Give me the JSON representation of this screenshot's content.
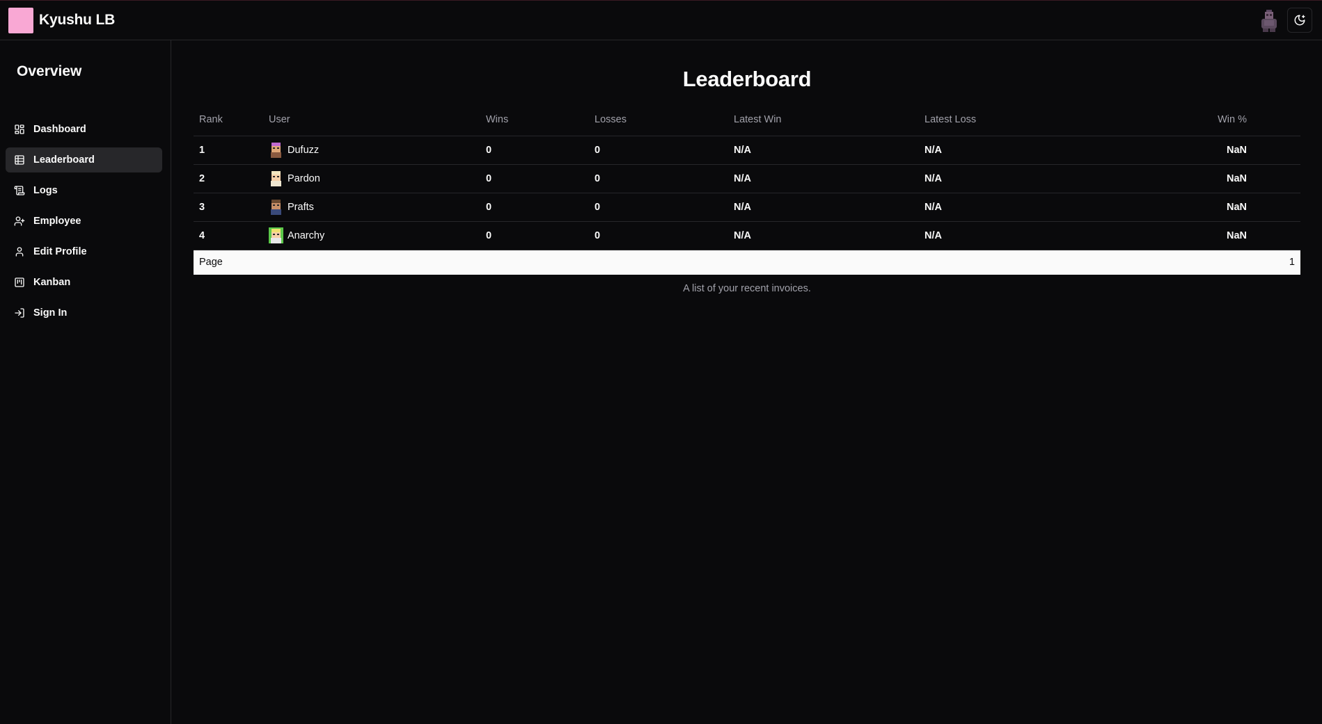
{
  "app": {
    "title": "Kyushu LB",
    "accent": "#f9a8d4"
  },
  "header": {
    "theme_toggle_icon": "moon-sun-icon",
    "avatar_icon": "user-avatar-icon"
  },
  "sidebar": {
    "heading": "Overview",
    "items": [
      {
        "label": "Dashboard",
        "icon": "dashboard-icon",
        "active": false
      },
      {
        "label": "Leaderboard",
        "icon": "table-icon",
        "active": true
      },
      {
        "label": "Logs",
        "icon": "scroll-icon",
        "active": false
      },
      {
        "label": "Employee",
        "icon": "user-plus-icon",
        "active": false
      },
      {
        "label": "Edit Profile",
        "icon": "user-icon",
        "active": false
      },
      {
        "label": "Kanban",
        "icon": "kanban-icon",
        "active": false
      },
      {
        "label": "Sign In",
        "icon": "sign-in-icon",
        "active": false
      }
    ]
  },
  "main": {
    "title": "Leaderboard",
    "table": {
      "columns": [
        "Rank",
        "User",
        "Wins",
        "Losses",
        "Latest Win",
        "Latest Loss",
        "Win %"
      ],
      "rows": [
        {
          "rank": "1",
          "user": "Dufuzz",
          "wins": "0",
          "losses": "0",
          "latest_win": "N/A",
          "latest_loss": "N/A",
          "win_pct": "NaN",
          "avatar_color": "#c06ad0"
        },
        {
          "rank": "2",
          "user": "Pardon",
          "wins": "0",
          "losses": "0",
          "latest_win": "N/A",
          "latest_loss": "N/A",
          "win_pct": "NaN",
          "avatar_color": "#f3e7c0"
        },
        {
          "rank": "3",
          "user": "Prafts",
          "wins": "0",
          "losses": "0",
          "latest_win": "N/A",
          "latest_loss": "N/A",
          "win_pct": "NaN",
          "avatar_color": "#8a6a4a"
        },
        {
          "rank": "4",
          "user": "Anarchy",
          "wins": "0",
          "losses": "0",
          "latest_win": "N/A",
          "latest_loss": "N/A",
          "win_pct": "NaN",
          "avatar_color": "#5cc84a"
        }
      ],
      "footer": {
        "label": "Page",
        "page": "1"
      }
    },
    "caption": "A list of your recent invoices."
  }
}
